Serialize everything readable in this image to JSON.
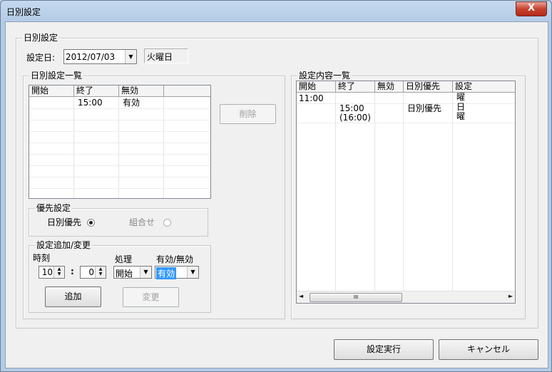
{
  "window": {
    "title": "日別設定",
    "close_glyph": "X"
  },
  "group_main": {
    "label": "日別設定"
  },
  "setting_date": {
    "label": "設定日:",
    "value": "2012/07/03",
    "weekday": "火曜日"
  },
  "list_group": {
    "label": "日別設定一覧",
    "columns": [
      "開始",
      "終了",
      "無効"
    ],
    "rows": [
      {
        "start": "",
        "end": "15:00",
        "disabled": "有効"
      }
    ]
  },
  "delete_button": "削除",
  "priority": {
    "label": "優先設定",
    "option_daily": "日別優先",
    "option_combo": "組合せ"
  },
  "add_change": {
    "label": "設定追加/変更",
    "time_label": "時刻",
    "hour": "10",
    "colon": ":",
    "minute": "0",
    "process_label": "処理",
    "process_value": "開始",
    "valid_label": "有効/無効",
    "valid_value": "有効",
    "add_button": "追加",
    "change_button": "変更"
  },
  "content_group": {
    "label": "設定内容一覧",
    "columns": [
      "開始",
      "終了",
      "無効",
      "日別優先",
      "設定"
    ],
    "cells": {
      "r1_start": "11:00",
      "r1_setting": "曜",
      "r2_end": "15:00",
      "r2_priority": "日別優先",
      "r2_setting": "日",
      "r3_end": "(16:00)",
      "r3_setting": "曜"
    },
    "scroll_thumb": "III"
  },
  "footer": {
    "execute_button": "設定実行",
    "cancel_button": "キャンセル"
  },
  "colors": {
    "selection": "#3399ff",
    "title_bar": "#b9d1ea"
  }
}
